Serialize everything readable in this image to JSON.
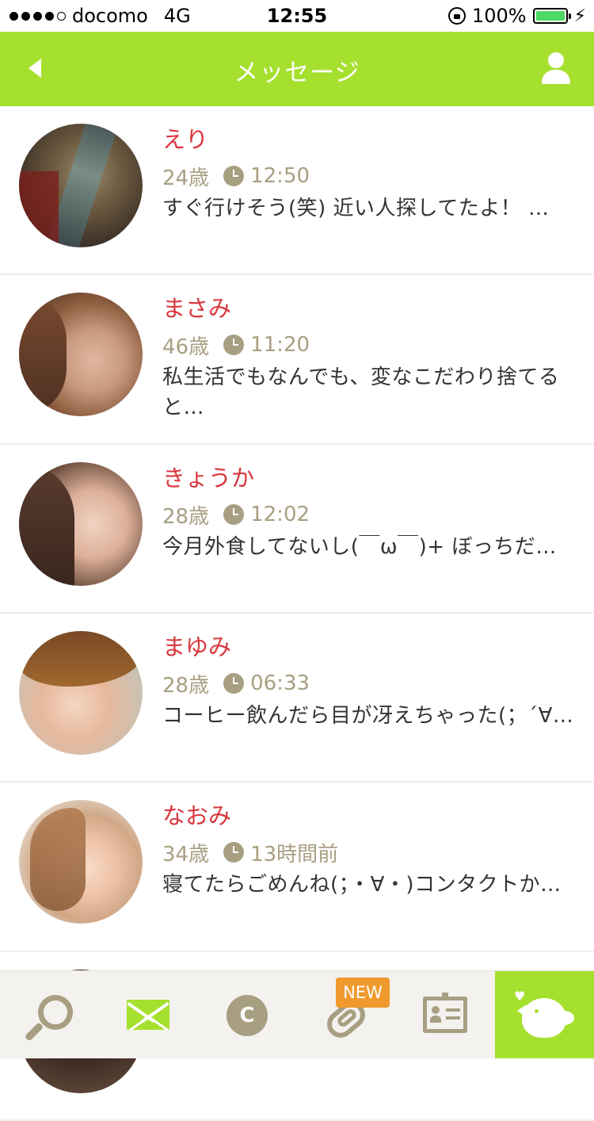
{
  "status_bar": {
    "carrier": "docomo",
    "network": "4G",
    "time": "12:55",
    "battery": "100%"
  },
  "header": {
    "title": "メッセージ"
  },
  "messages": [
    {
      "name": "えり",
      "age": "24歳",
      "time": "12:50",
      "text": "すぐ行けそう(笑) 近い人探してたよ！ …"
    },
    {
      "name": "まさみ",
      "age": "46歳",
      "time": "11:20",
      "text": "私生活でもなんでも、変なこだわり捨てると…"
    },
    {
      "name": "きょうか",
      "age": "28歳",
      "time": "12:02",
      "text": "今月外食してないし(￣ω￣)+ ぼっちだ…"
    },
    {
      "name": "まゆみ",
      "age": "28歳",
      "time": "06:33",
      "text": "コーヒー飲んだら目が冴えちゃった(；´∀…"
    },
    {
      "name": "なおみ",
      "age": "34歳",
      "time": "13時間前",
      "text": "寝てたらごめんね(；・∀・)コンタクトか…"
    }
  ],
  "tab_bar": {
    "coin_label": "C",
    "new_badge": "NEW"
  },
  "colors": {
    "accent": "#a5e02f",
    "name": "#d9363e",
    "meta": "#a89f82",
    "badge": "#f09a2e"
  }
}
